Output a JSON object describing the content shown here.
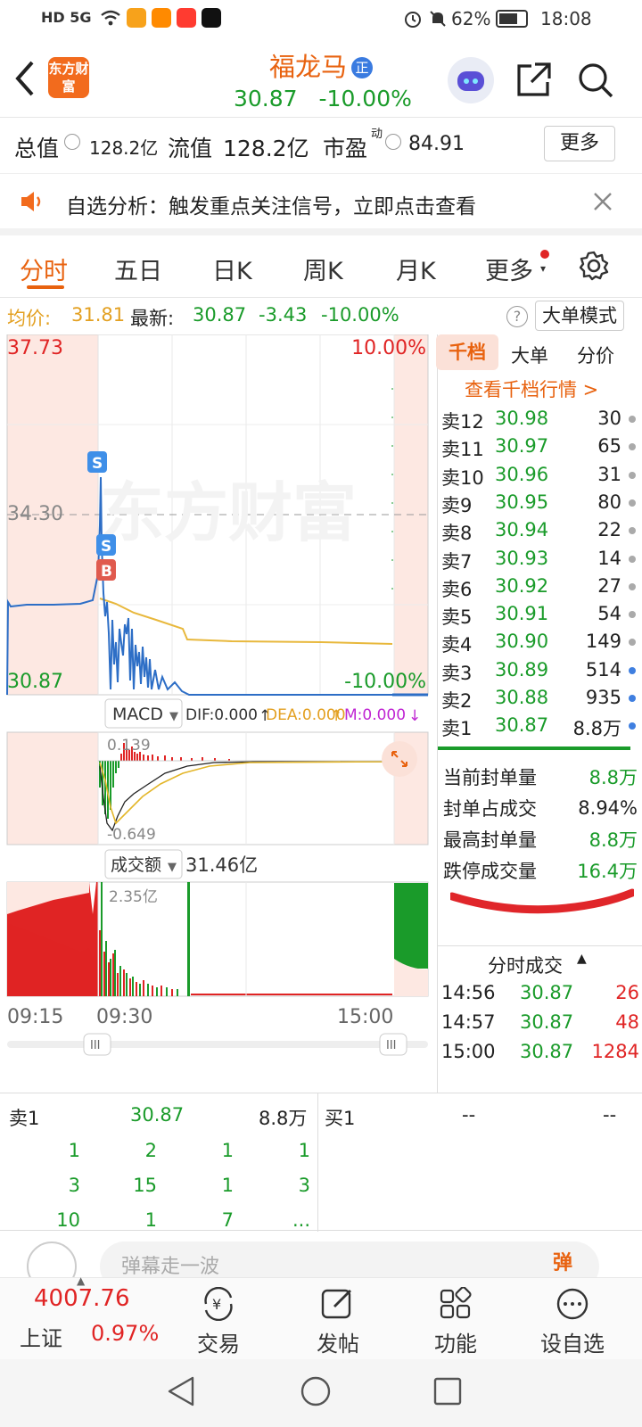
{
  "status": {
    "network": "HD 5G",
    "battery": "62%",
    "time": "18:08"
  },
  "header": {
    "app_logo": "东方财富",
    "stock_name": "福龙马",
    "badge": "正",
    "price": "30.87",
    "change_pct": "-10.00%"
  },
  "stats": {
    "total_label": "总值",
    "total_value": "128.2亿",
    "float_label": "流值",
    "float_value": "128.2亿",
    "pe_label": "市盈",
    "pe_sup": "动",
    "pe_value": "84.91",
    "more_button": "更多"
  },
  "notice": {
    "text": "自选分析：触发重点关注信号，立即点击查看"
  },
  "tabs": [
    "分时",
    "五日",
    "日K",
    "周K",
    "月K",
    "更多"
  ],
  "pricebar": {
    "avg_label": "均价:",
    "avg_value": "31.81",
    "latest_label": "最新:",
    "latest_value": "30.87",
    "change": "-3.43",
    "change_pct": "-10.00%",
    "mode_button": "大单模式"
  },
  "chart": {
    "y_max": "37.73",
    "y_mid": "34.30",
    "y_min": "30.87",
    "pct_max": "10.00%",
    "pct_min": "-10.00%",
    "watermark": "东方财富",
    "marker_s": "S",
    "marker_b": "B",
    "macd": {
      "label": "MACD",
      "dif": "DIF:0.000",
      "dea": "DEA:0.000",
      "m": "M:0.000",
      "top": "0.139",
      "bottom": "-0.649"
    },
    "volume": {
      "label": "成交额",
      "value": "31.46亿",
      "peak": "2.35亿"
    },
    "times": [
      "09:15",
      "09:30",
      "15:00"
    ],
    "scroll_handle": "III"
  },
  "book": {
    "tabs": [
      "千档",
      "大单",
      "分价"
    ],
    "view_link": "查看千档行情 >",
    "asks": [
      {
        "label": "卖12",
        "price": "30.98",
        "vol": "30"
      },
      {
        "label": "卖11",
        "price": "30.97",
        "vol": "65"
      },
      {
        "label": "卖10",
        "price": "30.96",
        "vol": "31"
      },
      {
        "label": "卖9",
        "price": "30.95",
        "vol": "80"
      },
      {
        "label": "卖8",
        "price": "30.94",
        "vol": "22"
      },
      {
        "label": "卖7",
        "price": "30.93",
        "vol": "14"
      },
      {
        "label": "卖6",
        "price": "30.92",
        "vol": "27"
      },
      {
        "label": "卖5",
        "price": "30.91",
        "vol": "54"
      },
      {
        "label": "卖4",
        "price": "30.90",
        "vol": "149"
      },
      {
        "label": "卖3",
        "price": "30.89",
        "vol": "514"
      },
      {
        "label": "卖2",
        "price": "30.88",
        "vol": "935"
      },
      {
        "label": "卖1",
        "price": "30.87",
        "vol": "8.8万"
      }
    ],
    "seal": [
      {
        "label": "当前封单量",
        "value": "8.8万"
      },
      {
        "label": "封单占成交",
        "value": "8.94%"
      },
      {
        "label": "最高封单量",
        "value": "8.8万"
      },
      {
        "label": "跌停成交量",
        "value": "16.4万"
      }
    ],
    "ticks_title": "分时成交",
    "ticks": [
      {
        "time": "14:56",
        "price": "30.87",
        "vol": "26"
      },
      {
        "time": "14:57",
        "price": "30.87",
        "vol": "48"
      },
      {
        "time": "15:00",
        "price": "30.87",
        "vol": "1284"
      }
    ]
  },
  "queue": {
    "sell_label": "卖1",
    "sell_price": "30.87",
    "sell_vol": "8.8万",
    "buy_label": "买1",
    "buy_price": "--",
    "buy_vol": "--",
    "rows": [
      [
        "1",
        "2",
        "1",
        "1"
      ],
      [
        "3",
        "15",
        "1",
        "3"
      ],
      [
        "10",
        "1",
        "7",
        "..."
      ]
    ]
  },
  "comment": {
    "placeholder": "弹幕走一波",
    "button": "弹"
  },
  "bottomnav": {
    "index_value": "4007.76",
    "index_name": "上证",
    "index_pct": "0.97%",
    "items": [
      "交易",
      "发帖",
      "功能",
      "设自选"
    ]
  }
}
